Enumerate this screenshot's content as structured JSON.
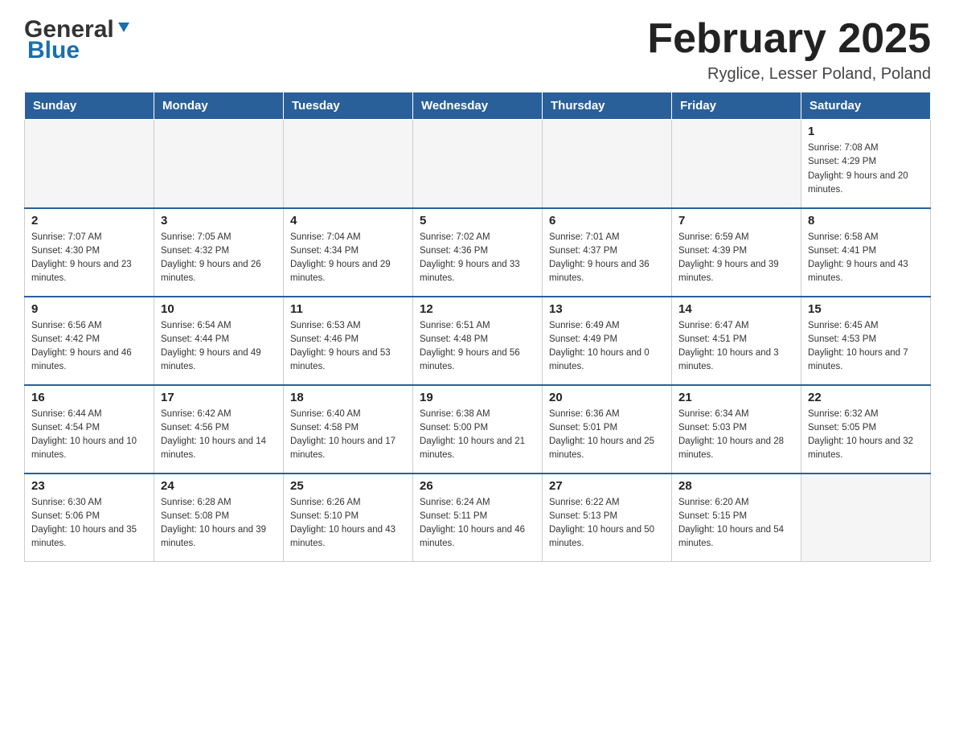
{
  "header": {
    "logo_general": "General",
    "logo_blue": "Blue",
    "month_title": "February 2025",
    "location": "Ryglice, Lesser Poland, Poland"
  },
  "days_of_week": [
    "Sunday",
    "Monday",
    "Tuesday",
    "Wednesday",
    "Thursday",
    "Friday",
    "Saturday"
  ],
  "weeks": [
    [
      {
        "day": "",
        "info": ""
      },
      {
        "day": "",
        "info": ""
      },
      {
        "day": "",
        "info": ""
      },
      {
        "day": "",
        "info": ""
      },
      {
        "day": "",
        "info": ""
      },
      {
        "day": "",
        "info": ""
      },
      {
        "day": "1",
        "info": "Sunrise: 7:08 AM\nSunset: 4:29 PM\nDaylight: 9 hours and 20 minutes."
      }
    ],
    [
      {
        "day": "2",
        "info": "Sunrise: 7:07 AM\nSunset: 4:30 PM\nDaylight: 9 hours and 23 minutes."
      },
      {
        "day": "3",
        "info": "Sunrise: 7:05 AM\nSunset: 4:32 PM\nDaylight: 9 hours and 26 minutes."
      },
      {
        "day": "4",
        "info": "Sunrise: 7:04 AM\nSunset: 4:34 PM\nDaylight: 9 hours and 29 minutes."
      },
      {
        "day": "5",
        "info": "Sunrise: 7:02 AM\nSunset: 4:36 PM\nDaylight: 9 hours and 33 minutes."
      },
      {
        "day": "6",
        "info": "Sunrise: 7:01 AM\nSunset: 4:37 PM\nDaylight: 9 hours and 36 minutes."
      },
      {
        "day": "7",
        "info": "Sunrise: 6:59 AM\nSunset: 4:39 PM\nDaylight: 9 hours and 39 minutes."
      },
      {
        "day": "8",
        "info": "Sunrise: 6:58 AM\nSunset: 4:41 PM\nDaylight: 9 hours and 43 minutes."
      }
    ],
    [
      {
        "day": "9",
        "info": "Sunrise: 6:56 AM\nSunset: 4:42 PM\nDaylight: 9 hours and 46 minutes."
      },
      {
        "day": "10",
        "info": "Sunrise: 6:54 AM\nSunset: 4:44 PM\nDaylight: 9 hours and 49 minutes."
      },
      {
        "day": "11",
        "info": "Sunrise: 6:53 AM\nSunset: 4:46 PM\nDaylight: 9 hours and 53 minutes."
      },
      {
        "day": "12",
        "info": "Sunrise: 6:51 AM\nSunset: 4:48 PM\nDaylight: 9 hours and 56 minutes."
      },
      {
        "day": "13",
        "info": "Sunrise: 6:49 AM\nSunset: 4:49 PM\nDaylight: 10 hours and 0 minutes."
      },
      {
        "day": "14",
        "info": "Sunrise: 6:47 AM\nSunset: 4:51 PM\nDaylight: 10 hours and 3 minutes."
      },
      {
        "day": "15",
        "info": "Sunrise: 6:45 AM\nSunset: 4:53 PM\nDaylight: 10 hours and 7 minutes."
      }
    ],
    [
      {
        "day": "16",
        "info": "Sunrise: 6:44 AM\nSunset: 4:54 PM\nDaylight: 10 hours and 10 minutes."
      },
      {
        "day": "17",
        "info": "Sunrise: 6:42 AM\nSunset: 4:56 PM\nDaylight: 10 hours and 14 minutes."
      },
      {
        "day": "18",
        "info": "Sunrise: 6:40 AM\nSunset: 4:58 PM\nDaylight: 10 hours and 17 minutes."
      },
      {
        "day": "19",
        "info": "Sunrise: 6:38 AM\nSunset: 5:00 PM\nDaylight: 10 hours and 21 minutes."
      },
      {
        "day": "20",
        "info": "Sunrise: 6:36 AM\nSunset: 5:01 PM\nDaylight: 10 hours and 25 minutes."
      },
      {
        "day": "21",
        "info": "Sunrise: 6:34 AM\nSunset: 5:03 PM\nDaylight: 10 hours and 28 minutes."
      },
      {
        "day": "22",
        "info": "Sunrise: 6:32 AM\nSunset: 5:05 PM\nDaylight: 10 hours and 32 minutes."
      }
    ],
    [
      {
        "day": "23",
        "info": "Sunrise: 6:30 AM\nSunset: 5:06 PM\nDaylight: 10 hours and 35 minutes."
      },
      {
        "day": "24",
        "info": "Sunrise: 6:28 AM\nSunset: 5:08 PM\nDaylight: 10 hours and 39 minutes."
      },
      {
        "day": "25",
        "info": "Sunrise: 6:26 AM\nSunset: 5:10 PM\nDaylight: 10 hours and 43 minutes."
      },
      {
        "day": "26",
        "info": "Sunrise: 6:24 AM\nSunset: 5:11 PM\nDaylight: 10 hours and 46 minutes."
      },
      {
        "day": "27",
        "info": "Sunrise: 6:22 AM\nSunset: 5:13 PM\nDaylight: 10 hours and 50 minutes."
      },
      {
        "day": "28",
        "info": "Sunrise: 6:20 AM\nSunset: 5:15 PM\nDaylight: 10 hours and 54 minutes."
      },
      {
        "day": "",
        "info": ""
      }
    ]
  ]
}
